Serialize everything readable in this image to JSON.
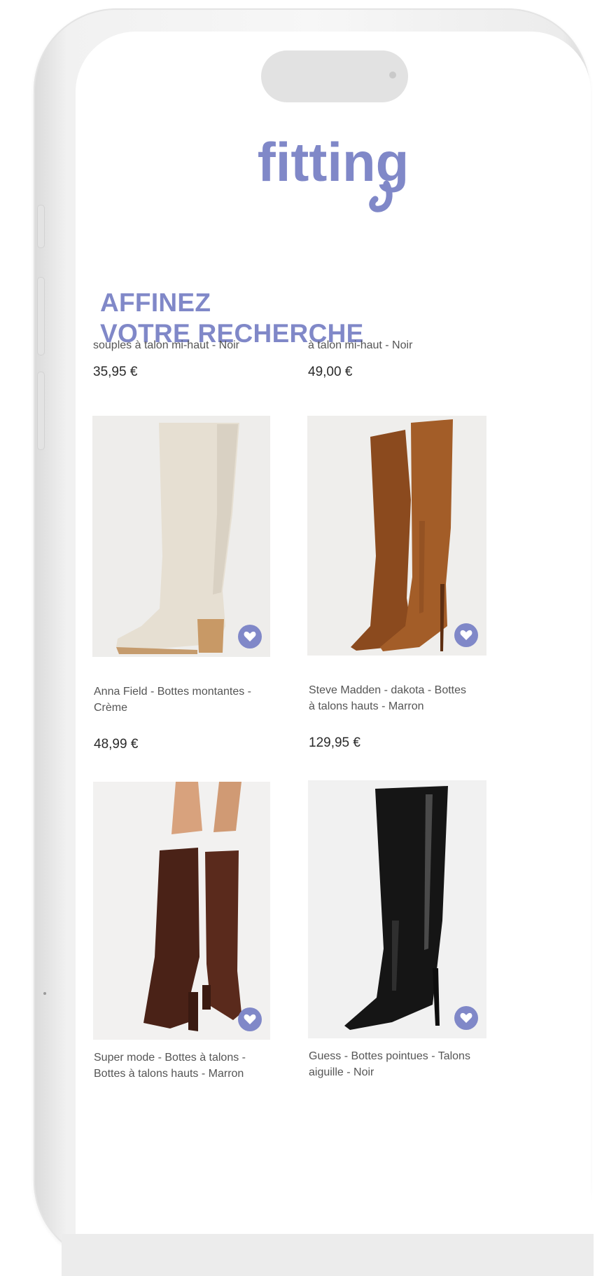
{
  "brand": {
    "logo_text": "fitting",
    "accent_color": "#8088c8"
  },
  "heading": {
    "line1": "AFFINEZ",
    "line2": "VOTRE RECHERCHE"
  },
  "products_partial": [
    {
      "name_tail": "souples à talon mi-haut - Noir",
      "price": "35,95 €"
    },
    {
      "name_tail": "à talon mi-haut - Noir",
      "price": "49,00 €"
    }
  ],
  "products": [
    {
      "name_line1": "Anna Field - Bottes montantes -",
      "name_line2": "Crème",
      "price": "48,99 €",
      "image": "cream-knee-boot",
      "favorite_icon": "heart-icon"
    },
    {
      "name_line1": "Steve Madden - dakota - Bottes",
      "name_line2": "à talons hauts - Marron",
      "price": "129,95 €",
      "image": "brown-suede-over-knee-boots",
      "favorite_icon": "heart-icon"
    },
    {
      "name_line1": "Super mode - Bottes à talons -",
      "name_line2": "Bottes à talons hauts - Marron",
      "image": "brown-croc-boots",
      "favorite_icon": "heart-icon"
    },
    {
      "name_line1": "Guess - Bottes pointues - Talons",
      "name_line2": "aiguille - Noir",
      "image": "black-patent-boot",
      "favorite_icon": "heart-icon"
    }
  ]
}
